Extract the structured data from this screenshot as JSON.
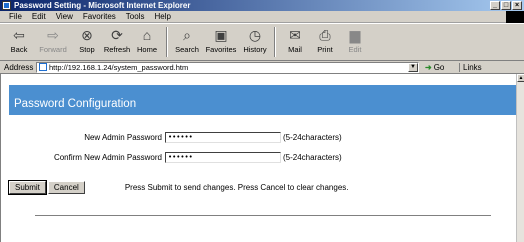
{
  "window": {
    "title": "Password Setting - Microsoft Internet Explorer",
    "controls": [
      "_",
      "□",
      "×"
    ]
  },
  "menubar": {
    "items": [
      "File",
      "Edit",
      "View",
      "Favorites",
      "Tools",
      "Help"
    ]
  },
  "toolbar": {
    "buttons": [
      {
        "label": "Back",
        "icon": "back-arrow-icon"
      },
      {
        "label": "Forward",
        "icon": "forward-arrow-icon"
      },
      {
        "label": "Stop",
        "icon": "stop-icon"
      },
      {
        "label": "Refresh",
        "icon": "refresh-icon"
      },
      {
        "label": "Home",
        "icon": "home-icon"
      },
      {
        "label": "Search",
        "icon": "search-icon"
      },
      {
        "label": "Favorites",
        "icon": "favorites-icon"
      },
      {
        "label": "History",
        "icon": "history-icon"
      },
      {
        "label": "Mail",
        "icon": "mail-icon"
      },
      {
        "label": "Print",
        "icon": "print-icon"
      },
      {
        "label": "Edit",
        "icon": "edit-icon"
      }
    ]
  },
  "address": {
    "label": "Address",
    "url": "http://192.168.1.24/system_password.htm",
    "go_label": "Go",
    "links_label": "Links"
  },
  "page": {
    "heading": "Password Configuration",
    "banner_color": "#4b8fd0",
    "fields": [
      {
        "label": "New Admin Password",
        "value": "••••••",
        "hint": "(5-24characters)"
      },
      {
        "label": "Confirm New Admin Password",
        "value": "••••••",
        "hint": "(5-24characters)"
      }
    ],
    "submit_label": "Submit",
    "cancel_label": "Cancel",
    "note": "Press Submit to send changes. Press Cancel to clear changes."
  }
}
